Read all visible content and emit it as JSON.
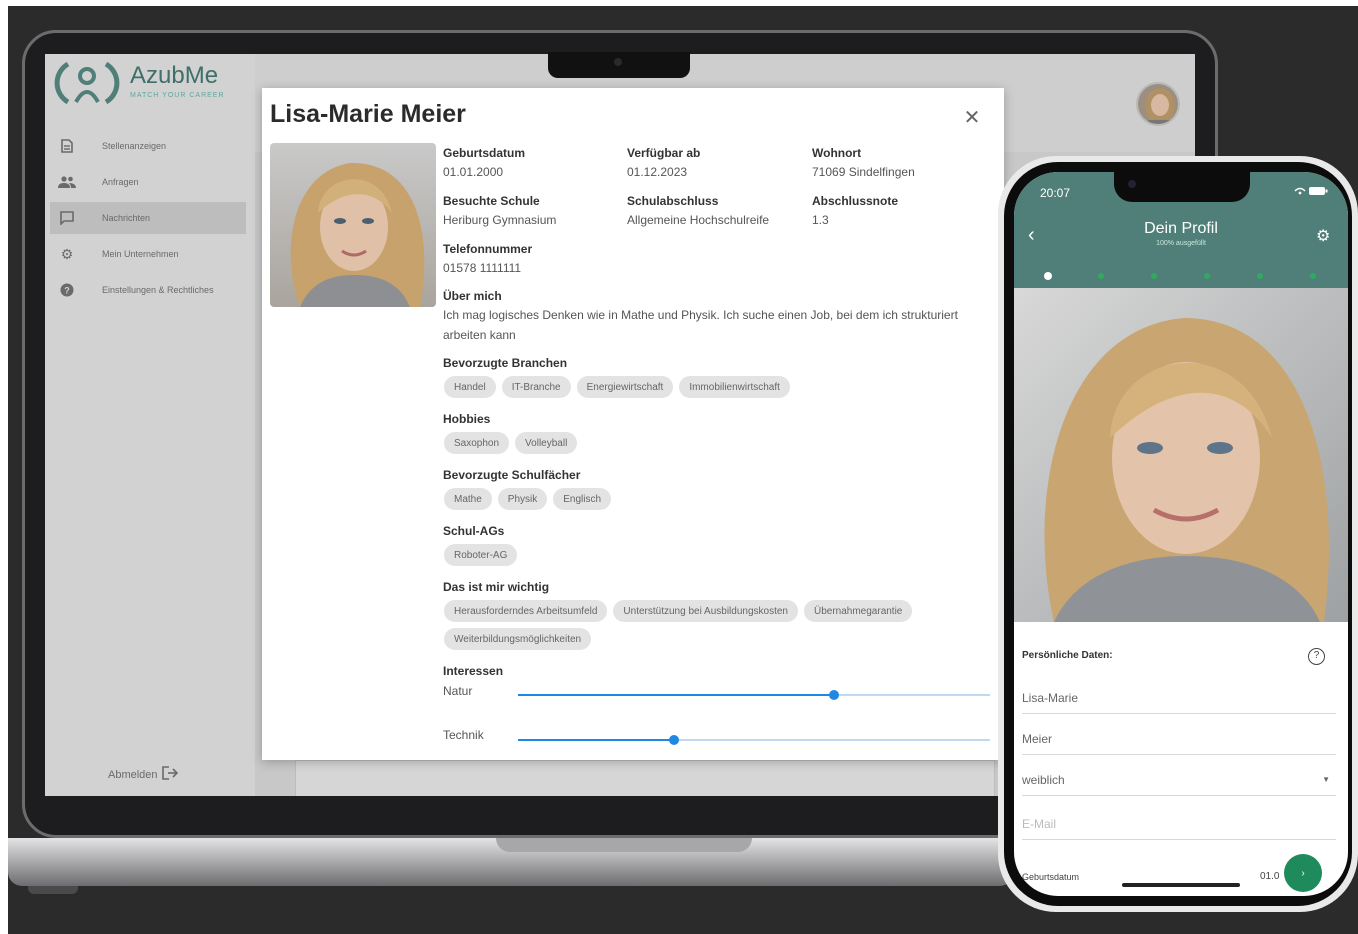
{
  "laptop": {
    "app": {
      "logo_text": "AzubMe",
      "logo_tagline": "MATCH YOUR CAREER",
      "sidebar": {
        "items": [
          {
            "label": "Stellenanzeigen",
            "icon": "document-icon"
          },
          {
            "label": "Anfragen",
            "icon": "people-icon"
          },
          {
            "label": "Nachrichten",
            "icon": "chat-icon",
            "active": true
          },
          {
            "label": "Mein Unternehmen",
            "icon": "gear-icon"
          },
          {
            "label": "Einstellungen & Rechtliches",
            "icon": "help-icon"
          }
        ],
        "logout_label": "Abmelden"
      }
    },
    "modal": {
      "title": "Lisa-Marie Meier",
      "close_icon": "close-icon",
      "fields": [
        {
          "label": "Geburtsdatum",
          "value": "01.01.2000"
        },
        {
          "label": "Verfügbar ab",
          "value": "01.12.2023"
        },
        {
          "label": "Wohnort",
          "value": "71069 Sindelfingen"
        },
        {
          "label": "Besuchte Schule",
          "value": "Heriburg Gymnasium"
        },
        {
          "label": "Schulabschluss",
          "value": "Allgemeine Hochschulreife"
        },
        {
          "label": "Abschlussnote",
          "value": "1.3"
        },
        {
          "label": "Telefonnummer",
          "value": "01578 1111111"
        }
      ],
      "about": {
        "label": "Über mich",
        "text": "Ich mag logisches Denken wie in Mathe und Physik. Ich suche einen Job, bei dem ich strukturiert arbeiten kann"
      },
      "sections": [
        {
          "label": "Bevorzugte Branchen",
          "chips": [
            "Handel",
            "IT-Branche",
            "Energiewirtschaft",
            "Immobilienwirtschaft"
          ]
        },
        {
          "label": "Hobbies",
          "chips": [
            "Saxophon",
            "Volleyball"
          ]
        },
        {
          "label": "Bevorzugte Schulfächer",
          "chips": [
            "Mathe",
            "Physik",
            "Englisch"
          ]
        },
        {
          "label": "Schul-AGs",
          "chips": [
            "Roboter-AG"
          ]
        },
        {
          "label": "Das ist mir wichtig",
          "chips": [
            "Herausforderndes Arbeitsumfeld",
            "Unterstützung bei Ausbildungskosten",
            "Übernahmegarantie",
            "Weiterbildungsmöglichkeiten"
          ]
        }
      ],
      "interests": {
        "label": "Interessen",
        "sliders": [
          {
            "label": "Natur",
            "value": 0.67
          },
          {
            "label": "Technik",
            "value": 0.33
          }
        ]
      }
    }
  },
  "phone": {
    "time": "20:07",
    "title": "Dein Profil",
    "subtitle": "100% ausgefüllt",
    "steps": {
      "count": 6,
      "current": 1
    },
    "section_label": "Persönliche Daten:",
    "help_icon": "?",
    "fields": [
      {
        "value": "Lisa-Marie",
        "placeholder": false
      },
      {
        "value": "Meier",
        "placeholder": false
      },
      {
        "value": "weiblich",
        "placeholder": false,
        "dropdown": true
      },
      {
        "value": "E-Mail",
        "placeholder": true
      }
    ],
    "bottom_label": "Geburtsdatum",
    "bottom_value": "01.0",
    "colors": {
      "header": "#4f7f78",
      "step_active": "#ffffff",
      "step_inactive": "#2faa62",
      "fab": "#1f8a5c"
    }
  }
}
